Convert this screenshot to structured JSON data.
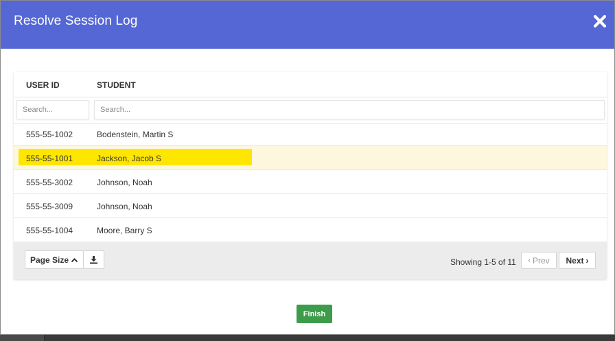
{
  "modal": {
    "title": "Resolve Session Log",
    "close_icon": "close-icon",
    "header_color": "#5467d4"
  },
  "grid": {
    "columns": [
      {
        "label": "USER ID"
      },
      {
        "label": "STUDENT"
      }
    ],
    "filters": [
      {
        "placeholder": "Search..."
      },
      {
        "placeholder": "Search..."
      }
    ],
    "rows": [
      {
        "user_id": "555-55-1002",
        "student": "Bodenstein, Martin S",
        "selected": false
      },
      {
        "user_id": "555-55-1001",
        "student": "Jackson, Jacob S",
        "selected": true
      },
      {
        "user_id": "555-55-3002",
        "student": "Johnson, Noah",
        "selected": false
      },
      {
        "user_id": "555-55-3009",
        "student": "Johnson, Noah",
        "selected": false
      },
      {
        "user_id": "555-55-1004",
        "student": "Moore, Barry S",
        "selected": false
      }
    ],
    "highlight_color": "#ffe600",
    "selected_row_color": "#fdf8dd"
  },
  "footer": {
    "page_size_label": "Page Size",
    "page_size_icon": "chevron-up-icon",
    "download_icon": "download-icon",
    "showing_text": "Showing 1-5 of 11",
    "prev_label": "Prev",
    "next_label": "Next"
  },
  "actions": {
    "finish_label": "Finish",
    "finish_color": "#3d9c4a"
  }
}
